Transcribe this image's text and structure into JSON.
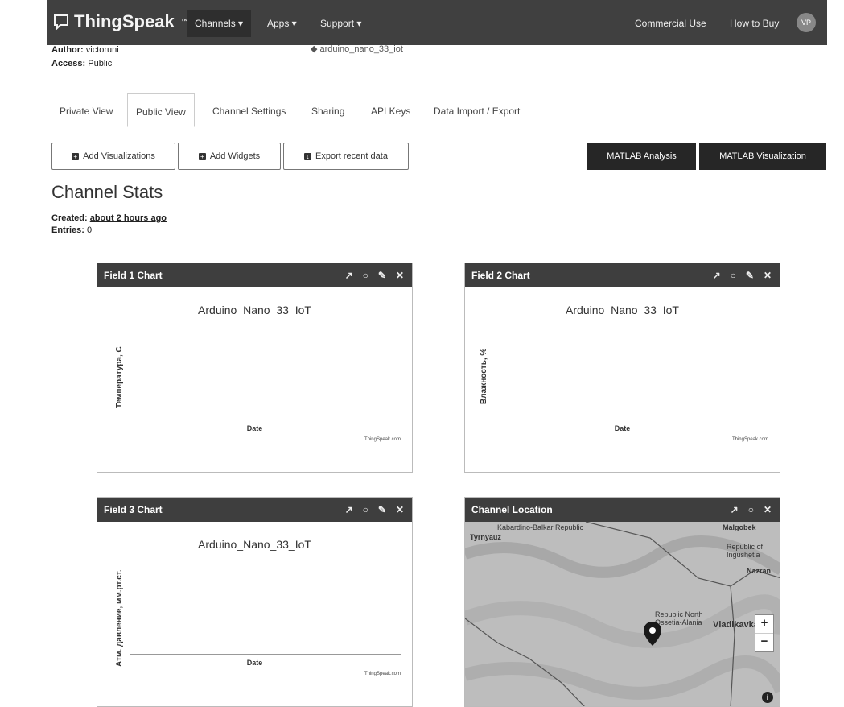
{
  "nav": {
    "brand": "ThingSpeak",
    "tm": "™",
    "channels": "Channels ▾",
    "apps": "Apps ▾",
    "support": "Support ▾",
    "commercial": "Commercial Use",
    "how_to_buy": "How to Buy",
    "avatar": "VP"
  },
  "meta": {
    "author_label": "Author:",
    "author": "victoruni",
    "access_label": "Access:",
    "access": "Public",
    "channel_tag": "arduino_nano_33_iot"
  },
  "tabs": [
    "Private View",
    "Public View",
    "Channel Settings",
    "Sharing",
    "API Keys",
    "Data Import / Export"
  ],
  "actions": {
    "add_visualizations": "Add Visualizations",
    "add_widgets": "Add Widgets",
    "export": "Export recent data",
    "matlab_analysis": "MATLAB Analysis",
    "matlab_visualization": "MATLAB Visualization"
  },
  "stats": {
    "title": "Channel Stats",
    "created_label": "Created:",
    "created": "about 2 hours ago",
    "entries_label": "Entries:",
    "entries": "0"
  },
  "charts": [
    {
      "header": "Field 1 Chart",
      "title": "Arduino_Nano_33_IoT",
      "ylabel": "Температура, С",
      "xlabel": "Date",
      "credit": "ThingSpeak.com"
    },
    {
      "header": "Field 2 Chart",
      "title": "Arduino_Nano_33_IoT",
      "ylabel": "Влажность, %",
      "xlabel": "Date",
      "credit": "ThingSpeak.com"
    },
    {
      "header": "Field 3 Chart",
      "title": "Arduino_Nano_33_IoT",
      "ylabel": "Атм. давление, мм.рт.ст.",
      "xlabel": "Date",
      "credit": "ThingSpeak.com"
    }
  ],
  "map": {
    "header": "Channel Location",
    "labels": [
      "Kabardino-Balkar Republic",
      "Tyrnyauz",
      "Malgobek",
      "Republic of Ingushetia",
      "Nazran",
      "Republic North Ossetia-Alania",
      "Vladikavkaz"
    ],
    "zoom_in": "+",
    "zoom_out": "−",
    "info": "i"
  }
}
